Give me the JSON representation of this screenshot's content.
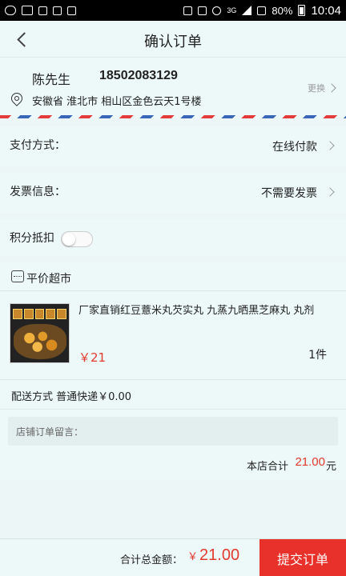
{
  "status_bar": {
    "battery": "80%",
    "time": "10:04",
    "network": "3G"
  },
  "nav": {
    "title": "确认订单"
  },
  "address": {
    "name": "陈先生",
    "phone": "18502083129",
    "detail": "安徽省 淮北市 相山区金色云天1号楼",
    "change_label": "更换"
  },
  "payment": {
    "label": "支付方式：",
    "value": "在线付款"
  },
  "invoice": {
    "label": "发票信息：",
    "value": "不需要发票"
  },
  "points": {
    "label": "积分抵扣",
    "enabled": false
  },
  "store": {
    "name": "平价超市",
    "product": {
      "title": "厂家直销红豆薏米丸芡实丸 九蒸九晒黑芝麻丸 丸剂",
      "price": "￥21",
      "quantity": "1件"
    },
    "delivery": "配送方式 普通快递￥0.00",
    "note_placeholder": "店铺订单留言：",
    "subtotal_label": "本店合计",
    "subtotal_amount": "21.00",
    "subtotal_unit": "元"
  },
  "footer": {
    "total_label": "合计总金额：",
    "currency": "￥",
    "total_amount": "21.00",
    "submit_label": "提交订单"
  },
  "colors": {
    "accent": "#e8312a",
    "background": "#edf6f6"
  }
}
